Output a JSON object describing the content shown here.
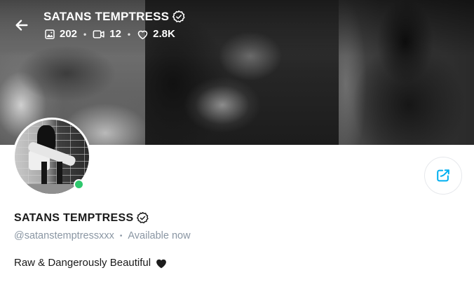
{
  "header": {
    "title": "SATANS TEMPTRESS",
    "stats": {
      "photos": "202",
      "videos": "12",
      "likes": "2.8K"
    }
  },
  "profile": {
    "name": "SATANS TEMPTRESS",
    "username": "@satanstemptressxxx",
    "status": "Available now",
    "bio": "Raw & Dangerously Beautiful"
  },
  "colors": {
    "online": "#2fc86d",
    "accent": "#00aff0",
    "muted": "#8a96a3"
  },
  "icons": {
    "back": "arrow-left-icon",
    "verified": "verified-badge-icon",
    "photos": "image-icon",
    "videos": "video-icon",
    "likes": "heart-icon",
    "share": "share-icon",
    "bio_emoji": "black-heart-emoji"
  }
}
